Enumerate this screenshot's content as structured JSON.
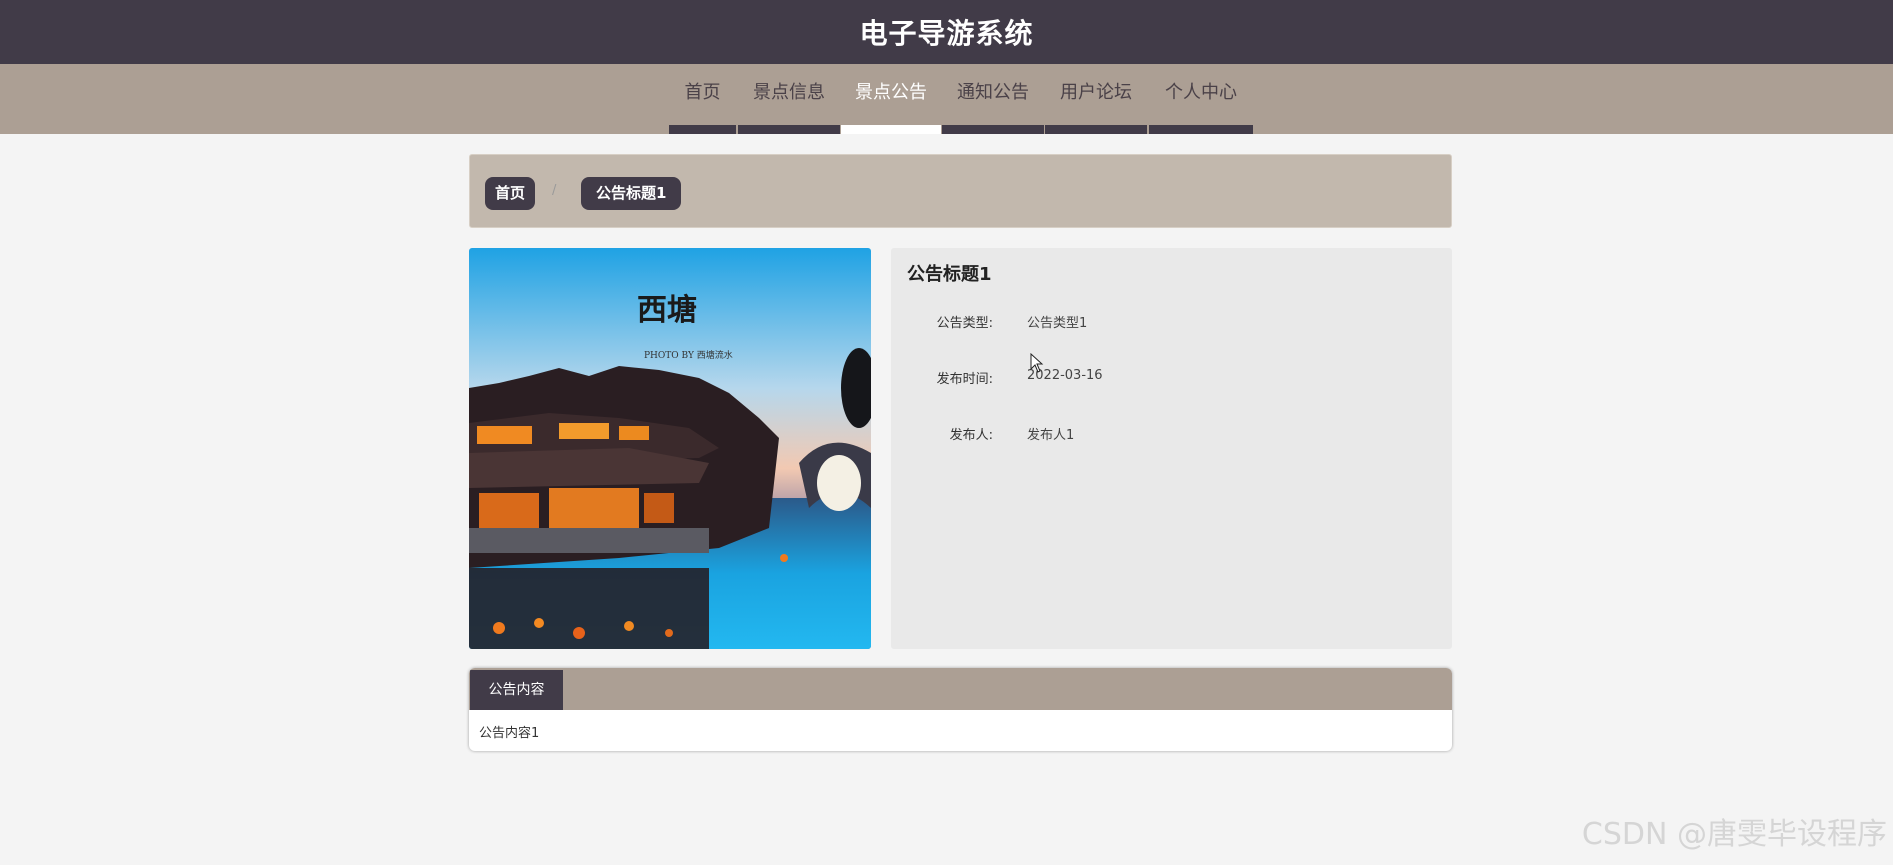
{
  "header": {
    "site_title": "电子导游系统"
  },
  "nav": {
    "items": [
      {
        "label": "首页",
        "active": false
      },
      {
        "label": "景点信息",
        "active": false
      },
      {
        "label": "景点公告",
        "active": true
      },
      {
        "label": "通知公告",
        "active": false
      },
      {
        "label": "用户论坛",
        "active": false
      },
      {
        "label": "个人中心",
        "active": false
      }
    ]
  },
  "breadcrumb": {
    "home": "首页",
    "separator": "/",
    "current": "公告标题1"
  },
  "image": {
    "calligraphy": "西塘",
    "credit": "PHOTO BY 西塘流水"
  },
  "detail": {
    "title": "公告标题1",
    "rows": [
      {
        "label": "公告类型:",
        "value": "公告类型1"
      },
      {
        "label": "发布时间:",
        "value": "2022-03-16"
      },
      {
        "label": "发布人:",
        "value": "发布人1"
      }
    ]
  },
  "content": {
    "tab_label": "公告内容",
    "body": "公告内容1"
  },
  "watermark": "CSDN @唐雯毕设程序",
  "colors": {
    "header_bg": "#413b48",
    "nav_bg": "#ac9f94",
    "breadcrumb_bg": "#c2b8ad",
    "info_bg": "#e9e9e9",
    "page_bg": "#f4f4f4"
  }
}
